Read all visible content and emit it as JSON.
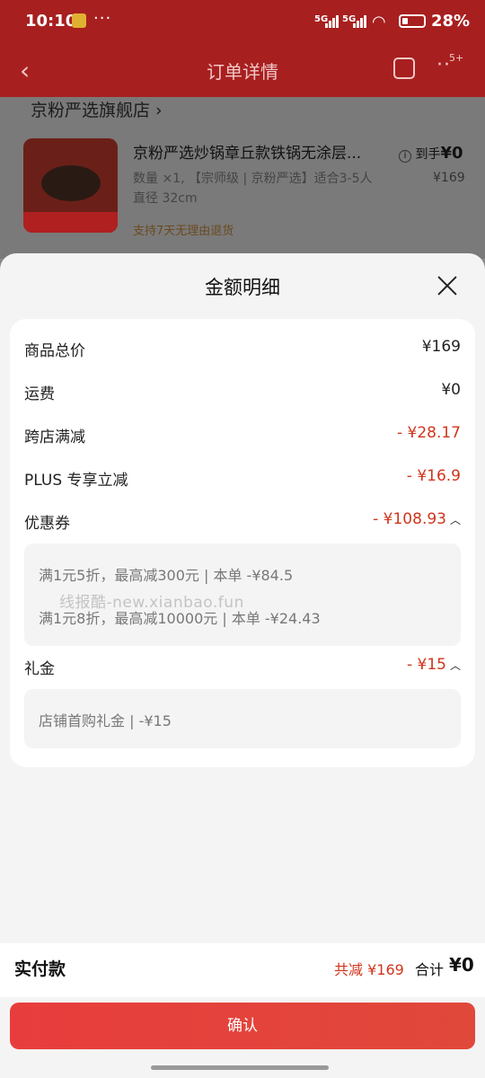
{
  "status_bar": {
    "time": "10:10",
    "more": "···",
    "network_1": "5G",
    "network_2": "5G",
    "battery": "28%"
  },
  "nav": {
    "title": "订单详情",
    "back_icon": "‹",
    "badge": "5+",
    "more_icon": "··"
  },
  "order": {
    "shop_name": "京粉严选旗舰店 ›",
    "product_title": "京粉严选炒锅章丘款铁锅无涂层...",
    "product_spec": "数量 ×1, 【宗师级 | 京粉严选】适合3-5人 直径 32cm",
    "return_policy": "支持7天无理由退货",
    "arrival_label": "到手",
    "arrival_price": "¥0",
    "price": "¥169"
  },
  "sheet": {
    "title": "金额明细",
    "rows": [
      {
        "label": "商品总价",
        "value": "¥169"
      },
      {
        "label": "运费",
        "value": "¥0"
      },
      {
        "label": "跨店满减",
        "value": "- ¥28.17"
      },
      {
        "label": "PLUS 专享立减",
        "value": "- ¥16.9"
      },
      {
        "label": "优惠券",
        "value": "- ¥108.93"
      },
      {
        "label": "礼金",
        "value": "- ¥15"
      }
    ],
    "coupon_details": [
      "满1元5折，最高减300元 | 本单 -¥84.5",
      "满1元8折，最高减10000元 | 本单 -¥24.43"
    ],
    "gift_details": [
      "店铺首购礼金 | -¥15"
    ],
    "watermark": "线报酷-new.xianbao.fun",
    "pay_label": "实付款",
    "saved": "共减 ¥169",
    "total_label": "合计",
    "total_value": "¥0",
    "confirm_label": "确认"
  },
  "colors": {
    "accent_red": "#d0351d",
    "button_red": "#e83d3d",
    "nav_red": "#a81f1f"
  },
  "icons": [
    "back-icon",
    "share-icon",
    "more-icon",
    "close-icon",
    "chevron-up-icon",
    "info-icon"
  ]
}
